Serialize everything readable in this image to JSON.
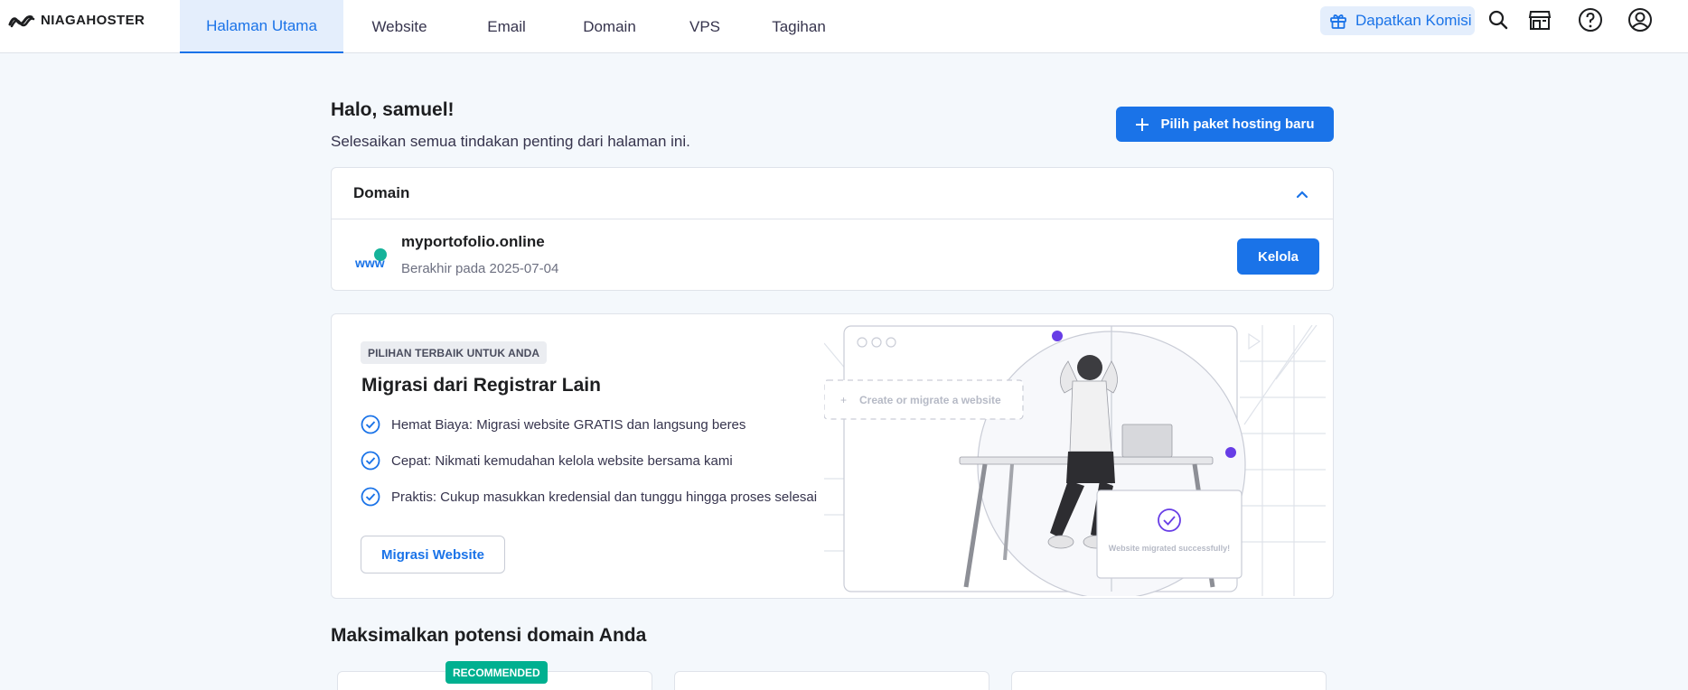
{
  "brand": {
    "name": "NIAGAHOSTER"
  },
  "nav": {
    "items": [
      {
        "label": "Halaman Utama",
        "active": true
      },
      {
        "label": "Website"
      },
      {
        "label": "Email"
      },
      {
        "label": "Domain"
      },
      {
        "label": "VPS"
      },
      {
        "label": "Tagihan"
      }
    ]
  },
  "header_actions": {
    "promo_label": "Dapatkan Komisi",
    "icons": [
      "search-icon",
      "store-icon",
      "help-icon",
      "account-icon"
    ]
  },
  "main": {
    "greeting": "Halo, samuel!",
    "subtitle": "Selesaikan semua tindakan penting dari halaman ini.",
    "new_hosting_label": "Pilih paket hosting baru"
  },
  "domain_card": {
    "title": "Domain",
    "domain_name": "myportofolio.online",
    "expiry": "Berakhir pada 2025-07-04",
    "manage_label": "Kelola"
  },
  "promo_card": {
    "tag": "PILIHAN TERBAIK UNTUK ANDA",
    "title": "Migrasi dari Registrar Lain",
    "features": [
      "Hemat Biaya: Migrasi website GRATIS dan langsung beres",
      "Cepat: Nikmati kemudahan kelola website bersama kami",
      "Praktis: Cukup masukkan kredensial dan tunggu hingga proses selesai"
    ],
    "cta_label": "Migrasi Website",
    "illustration": {
      "placeholder": "Create or migrate a website",
      "success": "Website migrated successfully!"
    }
  },
  "section2": {
    "title": "Maksimalkan potensi domain Anda",
    "badge": "RECOMMENDED"
  },
  "colors": {
    "accent": "#1a73e8",
    "badge": "#00b090",
    "background": "#f4f8fc"
  }
}
